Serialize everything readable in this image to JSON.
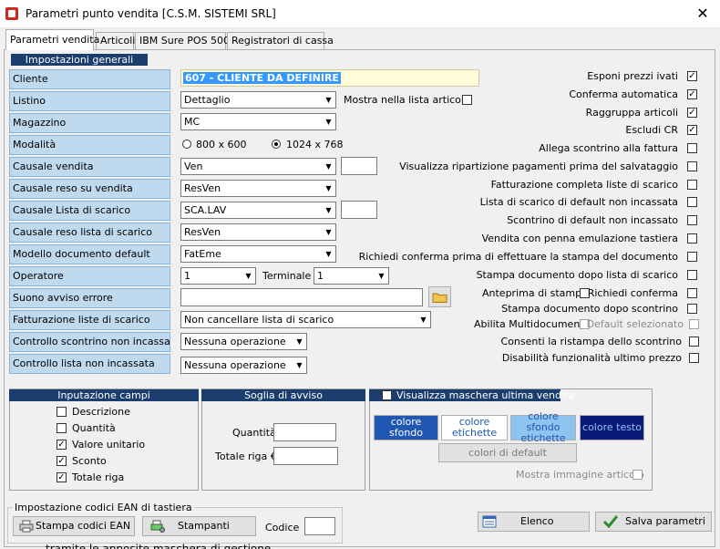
{
  "window": {
    "title": "Parametri punto vendita [C.S.M. SISTEMI SRL]",
    "close": "✕"
  },
  "tabs": [
    "Parametri vendita",
    "Articoli",
    "IBM Sure POS 500",
    "Registratori di cassa"
  ],
  "general": {
    "header": "Impostazioni generali",
    "cliente": {
      "label": "Cliente",
      "value": "607 - CLIENTE DA DEFINIRE"
    },
    "listino": {
      "label": "Listino",
      "value": "Dettaglio",
      "mostra": "Mostra nella lista articoli"
    },
    "magazzino": {
      "label": "Magazzino",
      "value": "MC"
    },
    "modalita": {
      "label": "Modalità",
      "opt1": "800 x 600",
      "opt2": "1024 x 768"
    },
    "causale_vendita": {
      "label": "Causale vendita",
      "value": "Ven"
    },
    "causale_reso": {
      "label": "Causale reso su vendita",
      "value": "ResVen"
    },
    "causale_lista": {
      "label": "Causale Lista di scarico",
      "value": "SCA.LAV"
    },
    "causale_reso_lista": {
      "label": "Causale reso lista di scarico",
      "value": "ResVen"
    },
    "modello": {
      "label": "Modello documento default",
      "value": "FatEme"
    },
    "operatore": {
      "label": "Operatore",
      "value": "1",
      "terminale_label": "Terminale",
      "terminale_value": "1"
    },
    "suono": {
      "label": "Suono avviso errore"
    },
    "fatturazione": {
      "label": "Fatturazione liste di scarico",
      "value": "Non cancellare lista di scarico"
    },
    "controllo_scontrino": {
      "label": "Controllo scontrino non incassato",
      "value": "Nessuna operazione"
    },
    "controllo_lista": {
      "label": "Controllo lista non incassata",
      "value": "Nessuna operazione"
    }
  },
  "options": [
    {
      "label": "Esponi prezzi ivati",
      "checked": true
    },
    {
      "label": "Conferma automatica",
      "checked": true
    },
    {
      "label": "Raggruppa articoli",
      "checked": true
    },
    {
      "label": "Escludi CR",
      "checked": true
    },
    {
      "label": "Allega scontrino alla fattura",
      "checked": false
    },
    {
      "label": "Visualizza ripartizione pagamenti prima del salvataggio",
      "checked": false
    },
    {
      "label": "Fatturazione completa  liste di scarico",
      "checked": false
    },
    {
      "label": "Lista di scarico di default non incassata",
      "checked": false
    },
    {
      "label": "Scontrino di default non incassato",
      "checked": false
    },
    {
      "label": "Vendita con penna emulazione tastiera",
      "checked": false
    },
    {
      "label": "Richiedi conferma prima di effettuare la stampa del documento",
      "checked": false
    },
    {
      "label": "Stampa documento dopo lista di scarico",
      "checked": false
    }
  ],
  "anteprima": {
    "label": "Anteprima di stampa",
    "richiedi": "Richiedi conferma"
  },
  "stampa_dopo_scontrino": "Stampa documento dopo scontrino",
  "multidoc": {
    "label": "Abilita Multidocumento",
    "default": "Default selezionato"
  },
  "ristampa": "Consenti la ristampa dello scontrino",
  "ultimo_prezzo": "Disabilità funzionalità ultimo prezzo",
  "inputazione": {
    "header": "Inputazione campi",
    "items": [
      {
        "label": "Descrizione",
        "checked": false
      },
      {
        "label": "Quantità",
        "checked": false
      },
      {
        "label": "Valore unitario",
        "checked": true
      },
      {
        "label": "Sconto",
        "checked": true
      },
      {
        "label": "Totale riga",
        "checked": true
      }
    ]
  },
  "soglia": {
    "header": "Soglia di avviso",
    "quantita": "Quantità",
    "totale": "Totale riga €"
  },
  "maschera": {
    "header": "Visualizza maschera ultima vendita",
    "sfondo": "colore sfondo",
    "etichette": "colore etichette",
    "sfondo_etichette": "colore sfondo etichette",
    "testo": "colore testo",
    "default": "colori di default",
    "mostra_img": "Mostra immagine articolo"
  },
  "ean": {
    "header": "Impostazione codici EAN di tastiera",
    "stampa": "Stampa codici EAN",
    "stampanti": "Stampanti",
    "codice": "Codice"
  },
  "buttons": {
    "elenco": "Elenco",
    "salva": "Salva parametri"
  },
  "bottom_text": "tramite le apposite maschera di gestione",
  "colors": {
    "header_blue": "#1c3e6e",
    "label_bg": "#bfd9ef",
    "clr_blue": "#1f57b3",
    "clr_light": "#8fc3f0",
    "clr_navy": "#0b1a7a"
  }
}
